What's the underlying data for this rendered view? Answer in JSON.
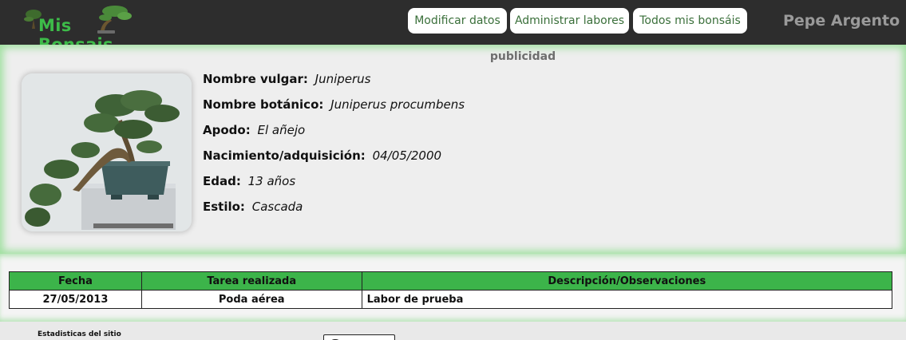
{
  "header": {
    "logo_text": "Mis Bonsais",
    "nav": [
      {
        "label": "Modificar datos"
      },
      {
        "label": "Administrar labores"
      },
      {
        "label": "Todos mis bonsáis"
      }
    ],
    "user_name": "Pepe Argento"
  },
  "ad_label": "publicidad",
  "bonsai": {
    "fields": [
      {
        "label": "Nombre vulgar:",
        "value": "Juniperus"
      },
      {
        "label": "Nombre botánico:",
        "value": "Juniperus procumbens"
      },
      {
        "label": "Apodo:",
        "value": "El añejo"
      },
      {
        "label": "Nacimiento/adquisición:",
        "value": "04/05/2000"
      },
      {
        "label": "Edad:",
        "value": "13 años"
      },
      {
        "label": "Estilo:",
        "value": "Cascada"
      }
    ]
  },
  "tasks_table": {
    "headers": [
      "Fecha",
      "Tarea realizada",
      "Descripción/Observaciones"
    ],
    "rows": [
      [
        "27/05/2013",
        "Poda aérea",
        "Labor de prueba"
      ]
    ]
  },
  "footer": {
    "stats_label": "Estadisticas del sitio"
  },
  "colors": {
    "header_bg": "#2d2d2d",
    "brand_green": "#3dbb49",
    "table_header_bg": "#3cb44a"
  }
}
